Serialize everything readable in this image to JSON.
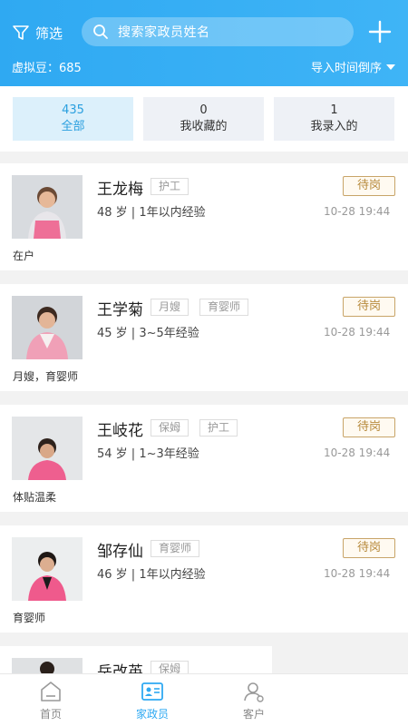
{
  "header": {
    "filter_label": "筛选",
    "search_placeholder": "搜索家政员姓名",
    "beans_label": "虚拟豆：685",
    "sort_label": "导入时间倒序"
  },
  "stats": [
    {
      "count": "435",
      "label": "全部",
      "active": true
    },
    {
      "count": "0",
      "label": "我收藏的",
      "active": false
    },
    {
      "count": "1",
      "label": "我录入的",
      "active": false
    }
  ],
  "workers": [
    {
      "name": "王龙梅",
      "tags": [
        "护工"
      ],
      "info": "48 岁 | 1年以内经验",
      "status": "待岗",
      "time": "10-28 19:44",
      "note": "在户"
    },
    {
      "name": "王学菊",
      "tags": [
        "月嫂",
        "育婴师"
      ],
      "info": "45 岁 | 3~5年经验",
      "status": "待岗",
      "time": "10-28 19:44",
      "note": "月嫂，育婴师"
    },
    {
      "name": "王岐花",
      "tags": [
        "保姆",
        "护工"
      ],
      "info": "54 岁 | 1~3年经验",
      "status": "待岗",
      "time": "10-28 19:44",
      "note": "体贴温柔"
    },
    {
      "name": "邹存仙",
      "tags": [
        "育婴师"
      ],
      "info": "46 岁 | 1年以内经验",
      "status": "待岗",
      "time": "10-28 19:44",
      "note": "育婴师"
    },
    {
      "name": "岳改英",
      "tags": [
        "保姆"
      ],
      "info": "",
      "status": "",
      "time": "",
      "note": ""
    }
  ],
  "nav": [
    {
      "label": "首页",
      "icon": "home-icon",
      "active": false
    },
    {
      "label": "家政员",
      "icon": "id-card-icon",
      "active": true
    },
    {
      "label": "客户",
      "icon": "customer-icon",
      "active": false
    }
  ],
  "colors": {
    "primary": "#2fa9f2",
    "status": "#b78a3c"
  }
}
